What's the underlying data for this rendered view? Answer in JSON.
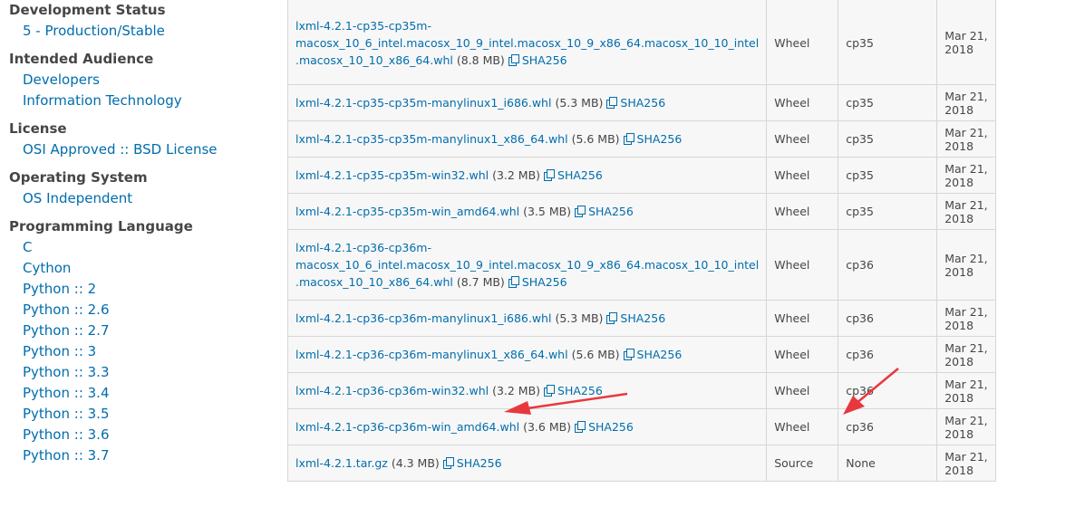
{
  "sidebar": {
    "categories": [
      {
        "title": "Development Status",
        "items": [
          "5 - Production/Stable"
        ]
      },
      {
        "title": "Intended Audience",
        "items": [
          "Developers",
          "Information Technology"
        ]
      },
      {
        "title": "License",
        "items": [
          "OSI Approved :: BSD License"
        ]
      },
      {
        "title": "Operating System",
        "items": [
          "OS Independent"
        ]
      },
      {
        "title": "Programming Language",
        "items": [
          "C",
          "Cython",
          "Python :: 2",
          "Python :: 2.6",
          "Python :: 2.7",
          "Python :: 3",
          "Python :: 3.3",
          "Python :: 3.4",
          "Python :: 3.5",
          "Python :: 3.6",
          "Python :: 3.7"
        ]
      }
    ]
  },
  "files": {
    "sha_label": "SHA256",
    "rows": [
      {
        "name": "lxml-4.2.1-cp35-cp35m-macosx_10_6_intel.macosx_10_9_intel.macosx_10_9_x86_64.macosx_10_10_intel.macosx_10_10_x86_64.whl",
        "lines": [
          "lxml-4.2.1-cp35-cp35m-",
          "macosx_10_6_intel.macosx_10_9_intel.macosx_10_9_x86_64.macosx_10_10_intel",
          ".macosx_10_10_x86_64.whl"
        ],
        "size": "(8.8 MB)",
        "type": "Wheel",
        "python": "cp35",
        "date": "Mar 21, 2018"
      },
      {
        "name": "lxml-4.2.1-cp35-cp35m-manylinux1_i686.whl",
        "lines": [
          "lxml-4.2.1-cp35-cp35m-manylinux1_i686.whl"
        ],
        "size": "(5.3 MB)",
        "type": "Wheel",
        "python": "cp35",
        "date": "Mar 21, 2018"
      },
      {
        "name": "lxml-4.2.1-cp35-cp35m-manylinux1_x86_64.whl",
        "lines": [
          "lxml-4.2.1-cp35-cp35m-manylinux1_x86_64.whl"
        ],
        "size": "(5.6 MB)",
        "type": "Wheel",
        "python": "cp35",
        "date": "Mar 21, 2018"
      },
      {
        "name": "lxml-4.2.1-cp35-cp35m-win32.whl",
        "lines": [
          "lxml-4.2.1-cp35-cp35m-win32.whl"
        ],
        "size": "(3.2 MB)",
        "type": "Wheel",
        "python": "cp35",
        "date": "Mar 21, 2018"
      },
      {
        "name": "lxml-4.2.1-cp35-cp35m-win_amd64.whl",
        "lines": [
          "lxml-4.2.1-cp35-cp35m-win_amd64.whl"
        ],
        "size": "(3.5 MB)",
        "type": "Wheel",
        "python": "cp35",
        "date": "Mar 21, 2018"
      },
      {
        "name": "lxml-4.2.1-cp36-cp36m-macosx_10_6_intel.macosx_10_9_intel.macosx_10_9_x86_64.macosx_10_10_intel.macosx_10_10_x86_64.whl",
        "lines": [
          "lxml-4.2.1-cp36-cp36m-",
          "macosx_10_6_intel.macosx_10_9_intel.macosx_10_9_x86_64.macosx_10_10_intel",
          ".macosx_10_10_x86_64.whl"
        ],
        "size": "(8.7 MB)",
        "type": "Wheel",
        "python": "cp36",
        "date": "Mar 21, 2018"
      },
      {
        "name": "lxml-4.2.1-cp36-cp36m-manylinux1_i686.whl",
        "lines": [
          "lxml-4.2.1-cp36-cp36m-manylinux1_i686.whl"
        ],
        "size": "(5.3 MB)",
        "type": "Wheel",
        "python": "cp36",
        "date": "Mar 21, 2018"
      },
      {
        "name": "lxml-4.2.1-cp36-cp36m-manylinux1_x86_64.whl",
        "lines": [
          "lxml-4.2.1-cp36-cp36m-manylinux1_x86_64.whl"
        ],
        "size": "(5.6 MB)",
        "type": "Wheel",
        "python": "cp36",
        "date": "Mar 21, 2018"
      },
      {
        "name": "lxml-4.2.1-cp36-cp36m-win32.whl",
        "lines": [
          "lxml-4.2.1-cp36-cp36m-win32.whl"
        ],
        "size": "(3.2 MB)",
        "type": "Wheel",
        "python": "cp36",
        "date": "Mar 21, 2018"
      },
      {
        "name": "lxml-4.2.1-cp36-cp36m-win_amd64.whl",
        "lines": [
          "lxml-4.2.1-cp36-cp36m-win_amd64.whl"
        ],
        "size": "(3.6 MB)",
        "type": "Wheel",
        "python": "cp36",
        "date": "Mar 21, 2018"
      },
      {
        "name": "lxml-4.2.1.tar.gz",
        "lines": [
          "lxml-4.2.1.tar.gz"
        ],
        "size": "(4.3 MB)",
        "type": "Source",
        "python": "None",
        "date": "Mar 21, 2018"
      }
    ]
  },
  "annotation_color": "#e8383d",
  "icons": {
    "copy": "copy-icon",
    "arrow": "arrow-annotation"
  }
}
